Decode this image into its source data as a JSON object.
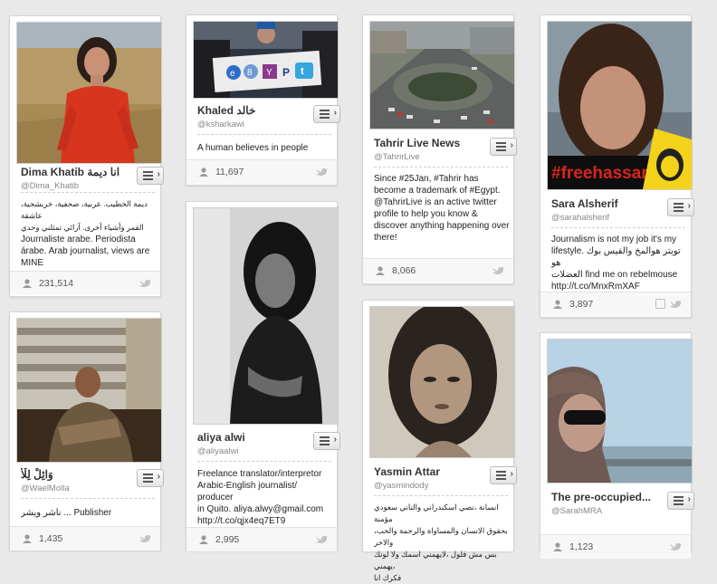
{
  "cards": [
    {
      "name": "Dima Khatib انا ديمة",
      "handle": "@Dima_Khatib",
      "bio": [
        "ديمة الخطيب. عربية، صحفية، خربشجية، عاشقة",
        "القمر وأشياء أخرى. آرائي تمثلني وحدي",
        "Journaliste arabe. Periodista",
        "árabe. Arab journalist, views are",
        "MINE"
      ],
      "followers": "231,514"
    },
    {
      "name": "Khaled خالد",
      "handle": "@ksharkawi",
      "bio": [
        "A human believes in people"
      ],
      "followers": "11,697",
      "photo_sign_letters": [
        "e",
        "8",
        "Y",
        "P",
        "t"
      ]
    },
    {
      "name": "Tahrir Live News",
      "handle": "@TahrirLive",
      "bio": [
        "Since #25Jan, #Tahrir has",
        "become a trademark of #Egypt.",
        "@TahrirLive is an active twitter",
        "profile to help you know &",
        "discover anything happening over",
        "there!"
      ],
      "followers": "8,066"
    },
    {
      "name": "Sara Alsherif",
      "handle": "@sarahalsherif",
      "bio": [
        "Journalism is not my job it's my",
        "lifestyle. تويتر هوالمخ والفيس بوك هو",
        "العضلات find me on rebelmouse",
        "http://t.co/MnxRmXAF"
      ],
      "followers": "3,897",
      "photo_tag": "#freehassan"
    },
    {
      "name": "وَائِلْ لِلْأ",
      "handle": "@WaelMolla",
      "bio": [
        "ناشر ويشر ... Publisher"
      ],
      "followers": "1,435"
    },
    {
      "name": "aliya alwi",
      "handle": "@aliyaalwi",
      "bio": [
        "Freelance translator/interpretor",
        "Arabic-English journalist/ producer",
        "in Quito. aliya.alwy@gmail.com",
        "http://t.co/qjx4eq7ET9"
      ],
      "followers": "2,995"
    },
    {
      "name": "Yasmin Attar",
      "handle": "@yasmindody",
      "bio": [
        "انسانة ،نصي اسكندراني والتاني سعودي مؤمنة",
        "بحقوق الانسان والمساواة والرحمة والحب، والاخر",
        "بس مش فلول ،لايهمني اسمك ولا لونك ،يهمني",
        "فكرك انا"
      ],
      "followers": ""
    },
    {
      "name": "The pre-occupied...",
      "handle": "@SarahMRA",
      "bio": [],
      "followers": "1,123"
    }
  ],
  "icons": {
    "list_button": "list-menu-icon",
    "followers": "user-icon",
    "twitter": "twitter-bird-icon",
    "instagram": "instagram-icon"
  },
  "colors": {
    "background": "#e9e9e9",
    "card": "#ffffff",
    "tag_red": "#d8241f",
    "tag_yellow": "#f3d21a"
  }
}
